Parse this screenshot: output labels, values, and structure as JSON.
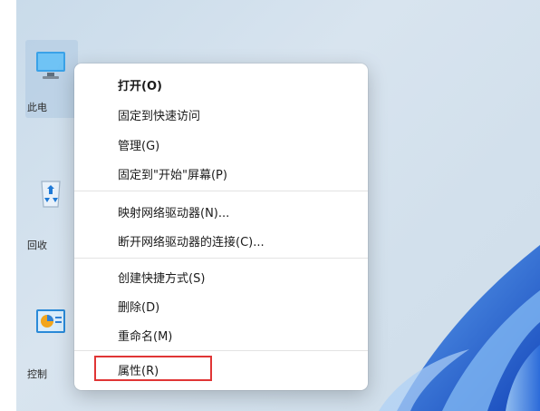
{
  "desktop_icons": [
    {
      "label": "此电",
      "icon": "monitor-icon",
      "selected": true
    },
    {
      "label": "回收",
      "icon": "recycle-bin-icon",
      "selected": false
    },
    {
      "label": "控制",
      "icon": "control-panel-icon",
      "selected": false
    }
  ],
  "context_menu": {
    "items": [
      {
        "label": "打开(O)",
        "bold": true
      },
      {
        "label": "固定到快速访问"
      },
      {
        "label": "管理(G)"
      },
      {
        "label": "固定到\"开始\"屏幕(P)"
      },
      {
        "label": "映射网络驱动器(N)..."
      },
      {
        "label": "断开网络驱动器的连接(C)..."
      },
      {
        "label": "创建快捷方式(S)"
      },
      {
        "label": "删除(D)"
      },
      {
        "label": "重命名(M)"
      },
      {
        "label": "属性(R)"
      }
    ],
    "highlight_color": "#e03535"
  },
  "colors": {
    "wallpaper": "#d2e0ec",
    "bloom": "#1f5fd0"
  }
}
